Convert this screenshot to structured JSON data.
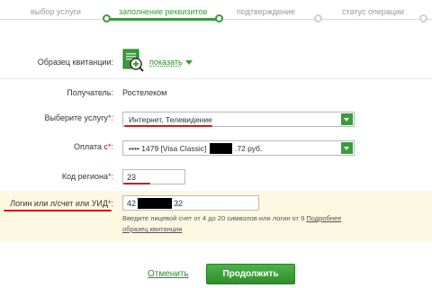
{
  "steps": [
    {
      "label": "выбор услуги",
      "state": "done"
    },
    {
      "label": "заполнение реквизитов",
      "state": "active"
    },
    {
      "label": "подтверждение",
      "state": "pending"
    },
    {
      "label": "статус операции",
      "state": "pending"
    }
  ],
  "sample": {
    "label": "Образец квитанции:",
    "link": "показать",
    "icon": "document-magnifier-icon"
  },
  "recipient": {
    "label": "Получатель:",
    "value": "Ростелеком"
  },
  "service": {
    "label": "Выберите услугу",
    "required_mark": "*:",
    "value": "Интернет, Телевидение"
  },
  "payment": {
    "label": "Оплата с",
    "required_mark": "*:",
    "card": "•••• 1479 [Visa Classic]",
    "amount_suffix": ".72 руб."
  },
  "region": {
    "label": "Код региона",
    "required_mark": "*:",
    "value": "23"
  },
  "login": {
    "label": "Логин или л/счет или УИД",
    "required_mark": "*:",
    "value_prefix": "42",
    "value_suffix": "32",
    "hint_line1": "Введите лицевой счет от 4 до 20 символов или логин от 9",
    "hint_link1": "Подробнее",
    "hint_link2": "образец квитанции"
  },
  "actions": {
    "cancel": "Отменить",
    "continue": "Продолжить"
  },
  "colors": {
    "accent_green": "#3a9b3a",
    "annotation_red": "#cc1b1b",
    "highlight_bg": "#fdf8e2"
  }
}
